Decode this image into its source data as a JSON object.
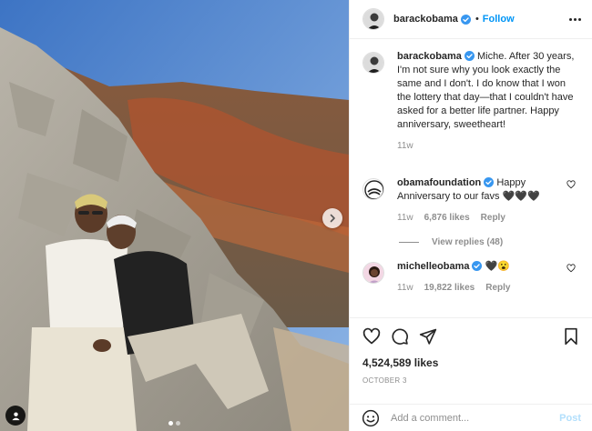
{
  "header": {
    "username": "barackobama",
    "separator": "•",
    "follow_label": "Follow"
  },
  "caption": {
    "username": "barackobama",
    "text": "Miche. After 30 years, I'm not sure why you look exactly the same and I don't. I do know that I won the lottery that day—that I couldn't have asked for a better life partner. Happy anniversary, sweetheart!",
    "timestamp": "11w"
  },
  "comments": [
    {
      "username": "obamafoundation",
      "text": "Happy Anniversary to our favs 🖤🖤🖤",
      "timestamp": "11w",
      "likes": "6,876 likes",
      "reply_label": "Reply",
      "view_replies": "View replies (48)"
    },
    {
      "username": "michelleobama",
      "text": "🖤😮",
      "timestamp": "11w",
      "likes": "19,822 likes",
      "reply_label": "Reply"
    }
  ],
  "likes_total": "4,524,589 likes",
  "post_date": "OCTOBER 3",
  "comment_box": {
    "placeholder": "Add a comment...",
    "post_label": "Post"
  },
  "carousel": {
    "slide_count": 2,
    "active_index": 0
  },
  "colors": {
    "accent": "#0095f6",
    "verified": "#3897f0",
    "muted": "#8e8e8e",
    "post_disabled": "#b2dffc"
  },
  "icons": [
    "chevron-right-icon",
    "tag-user-icon",
    "more-icon",
    "verified-icon",
    "heart-icon",
    "comment-icon",
    "share-icon",
    "bookmark-icon",
    "emoji-icon"
  ]
}
